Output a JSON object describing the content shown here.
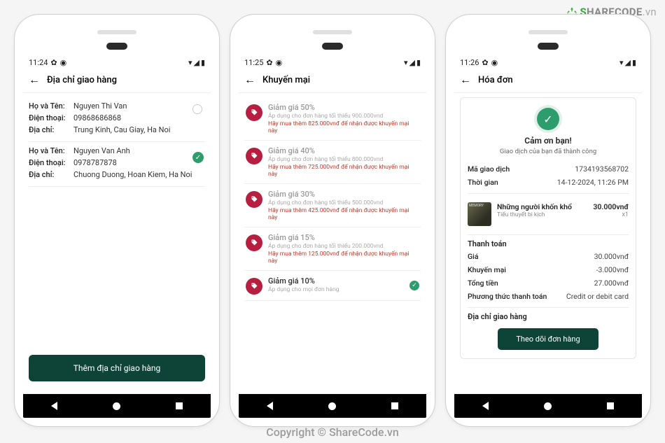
{
  "watermarks": {
    "logo_green": "S",
    "logo_rest": "HARECODE",
    "logo_suffix": ".vn",
    "center": "Copyright © ShareCode.vn",
    "right": "ShareCode.vn"
  },
  "common": {
    "labels": {
      "name": "Họ và Tên:",
      "phone": "Điện thoại:",
      "address": "Địa chỉ:"
    }
  },
  "phone1": {
    "status_time": "11:24",
    "appbar_title": "Địa chỉ giao hàng",
    "addresses": [
      {
        "name": "Nguyen Thi Van",
        "phone": "09868686868",
        "address": "Trung Kinh, Cau Giay, Ha Noi",
        "selected": false
      },
      {
        "name": "Nguyen Van Anh",
        "phone": "0978787878",
        "address": "Chuong Duong, Hoan Kiem, Ha Noi",
        "selected": true
      }
    ],
    "add_button": "Thêm địa chỉ giao hàng"
  },
  "phone2": {
    "status_time": "11:25",
    "appbar_title": "Khuyến mại",
    "promos": [
      {
        "title": "Giảm giá 50%",
        "sub": "Áp dụng cho đơn hàng tối thiểu 900.000vnd",
        "warn": "Hãy mua thêm 825.000vnđ để nhận được khuyến mại này",
        "disabled": true,
        "checked": false
      },
      {
        "title": "Giảm giá 40%",
        "sub": "Áp dụng cho đơn hàng tối thiểu 800.000vnd",
        "warn": "Hãy mua thêm 725.000vnđ để nhận được khuyến mại này",
        "disabled": true,
        "checked": false
      },
      {
        "title": "Giảm giá 30%",
        "sub": "Áp dụng cho đơn hàng tối thiểu 500.000vnd",
        "warn": "Hãy mua thêm 425.000vnđ để nhận được khuyến mại này",
        "disabled": true,
        "checked": false
      },
      {
        "title": "Giảm giá 15%",
        "sub": "Áp dụng cho đơn hàng tối thiểu 200.000vnd",
        "warn": "Hãy mua thêm 125.000vnđ để nhận được khuyến mại này",
        "disabled": true,
        "checked": false
      },
      {
        "title": "Giảm giá 10%",
        "sub": "Áp dụng cho mọi đơn hàng",
        "warn": "",
        "disabled": false,
        "checked": true
      }
    ]
  },
  "phone3": {
    "status_time": "11:26",
    "appbar_title": "Hóa đơn",
    "thanks": "Cảm ơn bạn!",
    "desc": "Giao dịch của bạn đã thành công",
    "tx_label": "Mã giao dịch",
    "tx_value": "1734193568702",
    "time_label": "Thời gian",
    "time_value": "14-12-2024, 11:26 PM",
    "item": {
      "title": "Những người khốn khổ",
      "sub": "Tiểu thuyết bi kịch",
      "price": "30.000vnđ",
      "qty": "x1"
    },
    "pay_section": "Thanh toán",
    "rows": [
      {
        "k": "Giá",
        "v": "30.000vnđ"
      },
      {
        "k": "Khuyến mại",
        "v": "-3.000vnđ"
      },
      {
        "k": "Tổng tiền",
        "v": "27.000vnđ"
      },
      {
        "k": "Phương thức thanh toán",
        "v": "Credit or debit card"
      }
    ],
    "ship_section": "Địa chỉ giao hàng",
    "track_button": "Theo dõi đơn hàng"
  }
}
